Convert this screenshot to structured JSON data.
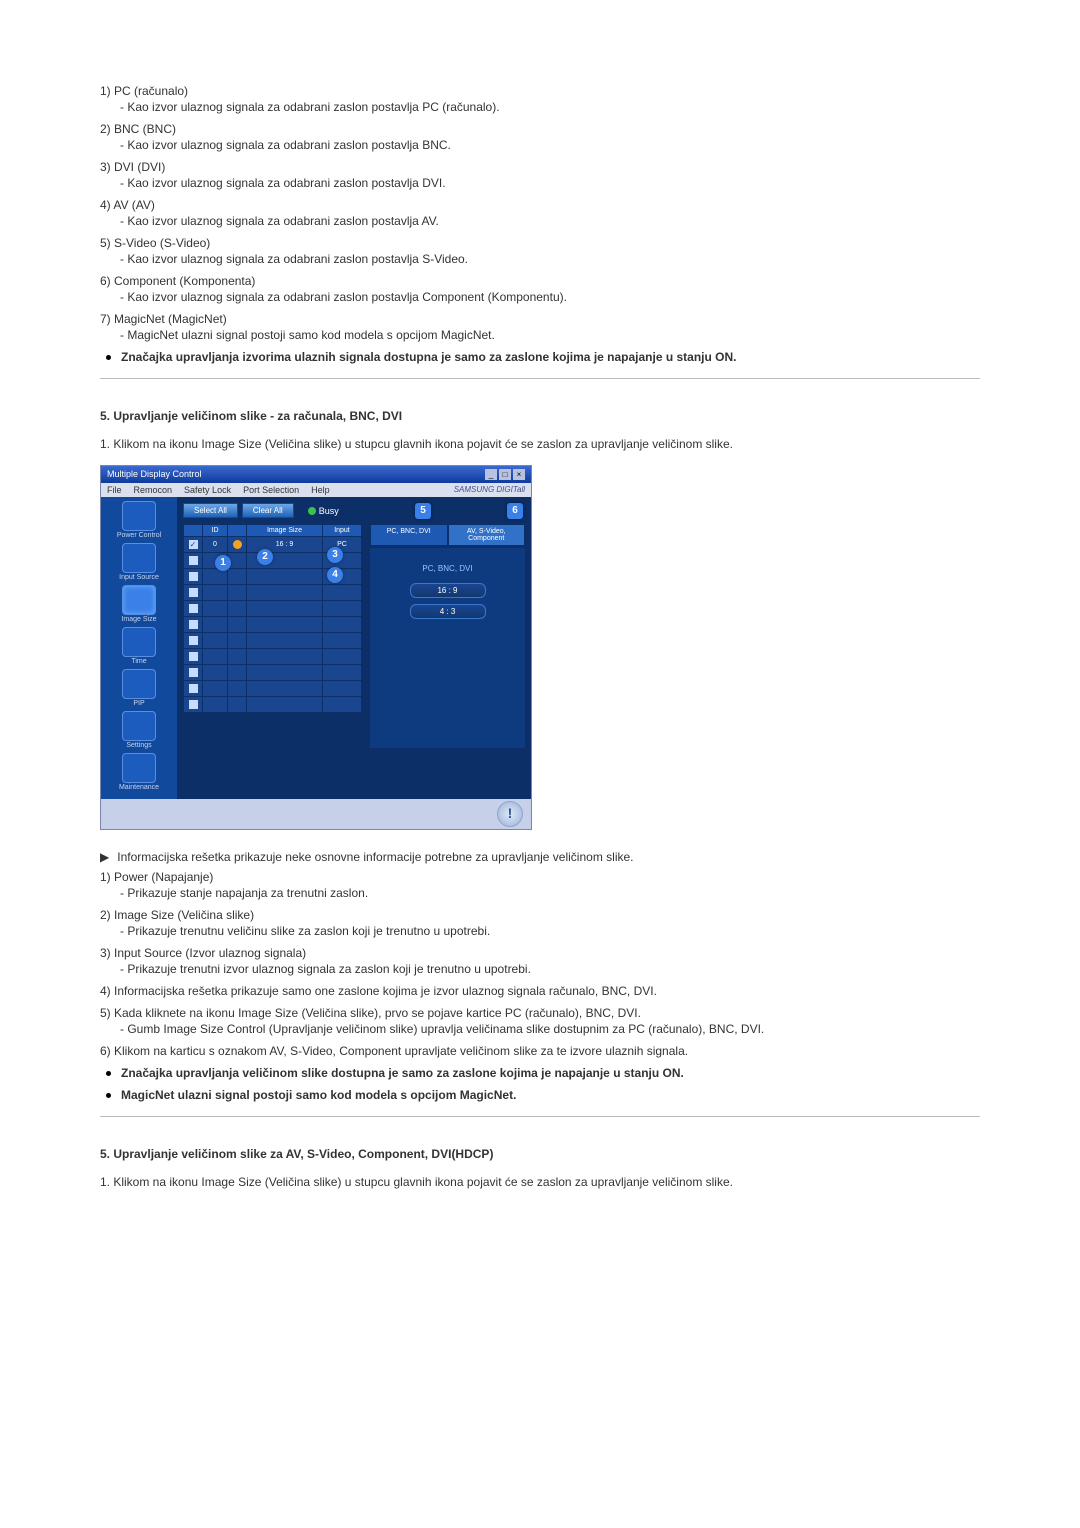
{
  "sourceList": [
    {
      "num": "1) ",
      "title": "PC (računalo)",
      "desc": "Kao izvor ulaznog signala za odabrani zaslon postavlja PC (računalo)."
    },
    {
      "num": "2) ",
      "title": "BNC (BNC)",
      "desc": "Kao izvor ulaznog signala za odabrani zaslon postavlja BNC."
    },
    {
      "num": "3) ",
      "title": "DVI (DVI)",
      "desc": "Kao izvor ulaznog signala za odabrani zaslon postavlja DVI."
    },
    {
      "num": "4) ",
      "title": "AV (AV)",
      "desc": "Kao izvor ulaznog signala za odabrani zaslon postavlja AV."
    },
    {
      "num": "5) ",
      "title": "S-Video (S-Video)",
      "desc": "Kao izvor ulaznog signala za odabrani zaslon postavlja S-Video."
    },
    {
      "num": "6) ",
      "title": "Component (Komponenta)",
      "desc": "Kao izvor ulaznog signala za odabrani zaslon postavlja Component (Komponentu)."
    },
    {
      "num": "7) ",
      "title": "MagicNet (MagicNet)",
      "desc": "MagicNet ulazni signal postoji samo kod modela s opcijom MagicNet."
    }
  ],
  "bullet1": "Značajka upravljanja izvorima ulaznih signala dostupna je samo za zaslone kojima je napajanje u stanju ON.",
  "sectionA": {
    "title": "5. Upravljanje veličinom slike - za računala, BNC, DVI",
    "intro": "1.  Klikom na ikonu Image Size (Veličina slike) u stupcu glavnih ikona pojavit će se zaslon za upravljanje veličinom slike."
  },
  "app": {
    "title": "Multiple Display Control",
    "menu": [
      "File",
      "Remocon",
      "Safety Lock",
      "Port Selection",
      "Help"
    ],
    "brand": "SAMSUNG DIGITall",
    "side": [
      "Power Control",
      "Input Source",
      "Image Size",
      "Time",
      "PIP",
      "Settings",
      "Maintenance"
    ],
    "selectAll": "Select All",
    "clearAll": "Clear All",
    "busy": "Busy",
    "cols": {
      "id": "ID",
      "size": "Image Size",
      "input": "Input"
    },
    "row": {
      "id": "0",
      "size": "16 : 9",
      "input": "PC"
    },
    "tab1": "PC, BNC, DVI",
    "tab2": "AV, S-Video, Component",
    "panelTitle": "PC, BNC, DVI",
    "opt1": "16 : 9",
    "opt2": "4 : 3",
    "callouts": {
      "c1": "1",
      "c2": "2",
      "c3": "3",
      "c4": "4",
      "c5": "5",
      "c6": "6"
    }
  },
  "arrowText": "Informacijska rešetka prikazuje neke osnovne informacije potrebne za upravljanje veličinom slike.",
  "lowerList": [
    {
      "n": "1) ",
      "t": "Power (Napajanje)",
      "d": "Prikazuje stanje napajanja za trenutni zaslon."
    },
    {
      "n": "2) ",
      "t": "Image Size (Veličina slike)",
      "d": "Prikazuje trenutnu veličinu slike za zaslon koji je trenutno u upotrebi."
    },
    {
      "n": "3) ",
      "t": "Input Source (Izvor ulaznog signala)",
      "d": "Prikazuje trenutni izvor ulaznog signala za zaslon koji je trenutno u upotrebi."
    }
  ],
  "line4": "4)  Informacijska rešetka prikazuje samo one zaslone kojima je izvor ulaznog signala računalo, BNC, DVI.",
  "line5": "5)  Kada kliknete na ikonu Image Size (Veličina slike), prvo se pojave kartice PC (računalo), BNC, DVI.",
  "line5d": "Gumb Image Size Control (Upravljanje veličinom slike) upravlja veličinama slike dostupnim za PC (računalo), BNC, DVI.",
  "line6": "6)  Klikom na karticu s oznakom AV, S-Video, Component upravljate veličinom slike za te izvore ulaznih signala.",
  "bullet2": "Značajka upravljanja veličinom slike dostupna je samo za zaslone kojima je napajanje u stanju ON.",
  "bullet3": "MagicNet ulazni signal postoji samo kod modela s opcijom MagicNet.",
  "sectionB": {
    "title": "5. Upravljanje veličinom slike za AV, S-Video, Component, DVI(HDCP)",
    "intro": "1.  Klikom na ikonu Image Size (Veličina slike) u stupcu glavnih ikona pojavit će se zaslon za upravljanje veličinom slike."
  }
}
